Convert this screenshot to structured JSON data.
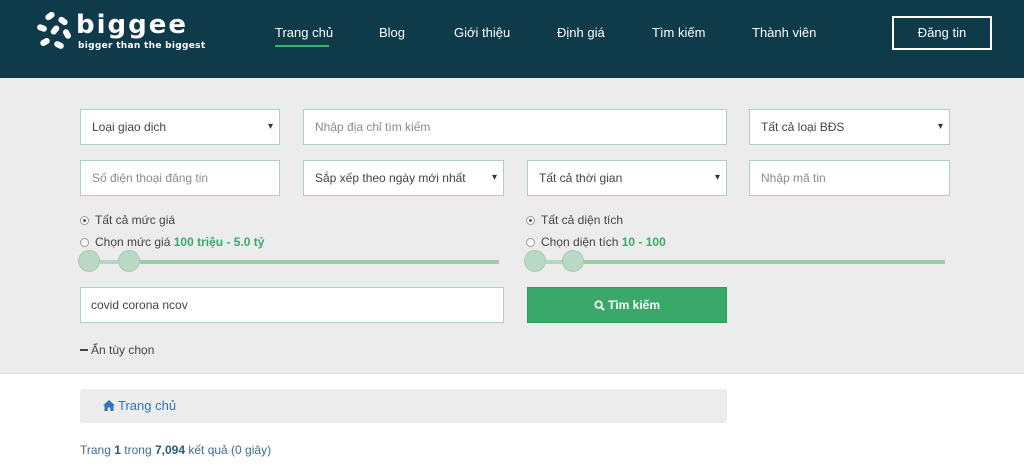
{
  "brand": {
    "name": "biggee",
    "tagline": "bigger than the biggest"
  },
  "nav": {
    "items": [
      "Trang chủ",
      "Blog",
      "Giới thiệu",
      "Định giá",
      "Tìm kiếm",
      "Thành viên"
    ],
    "active_index": 0,
    "post_button": "Đăng tin"
  },
  "search": {
    "transaction_type": "Loại giao dịch",
    "address_placeholder": "Nhập địa chỉ tìm kiếm",
    "property_type": "Tất cả loại BĐS",
    "phone_placeholder": "Số điện thoại đăng tin",
    "sort_by": "Sắp xếp theo ngày mới nhất",
    "time_range": "Tất cả thời gian",
    "code_placeholder": "Nhập mã tin",
    "price": {
      "all_label": "Tất cả mức giá",
      "choose_label": "Chọn mức giá",
      "range": "100 triệu - 5.0 tỷ",
      "selected": "all"
    },
    "area": {
      "all_label": "Tất cả diện tích",
      "choose_label": "Chọn diện tích",
      "range": "10 - 100",
      "selected": "all"
    },
    "keyword": "covid corona ncov",
    "search_button": "Tìm kiếm",
    "toggle_options": "Ẩn tùy chọn"
  },
  "breadcrumb": {
    "home": "Trang chủ"
  },
  "results": {
    "prefix": "Trang",
    "page": "1",
    "middle": "trong",
    "total": "7,094",
    "suffix": "kết quả (0 giây)"
  },
  "colors": {
    "header_bg": "#0f3a4a",
    "accent": "#3aa86a",
    "link": "#3374b8"
  },
  "icons": {
    "logo": "biggee-logo-icon",
    "search": "search-icon",
    "home": "home-icon"
  }
}
